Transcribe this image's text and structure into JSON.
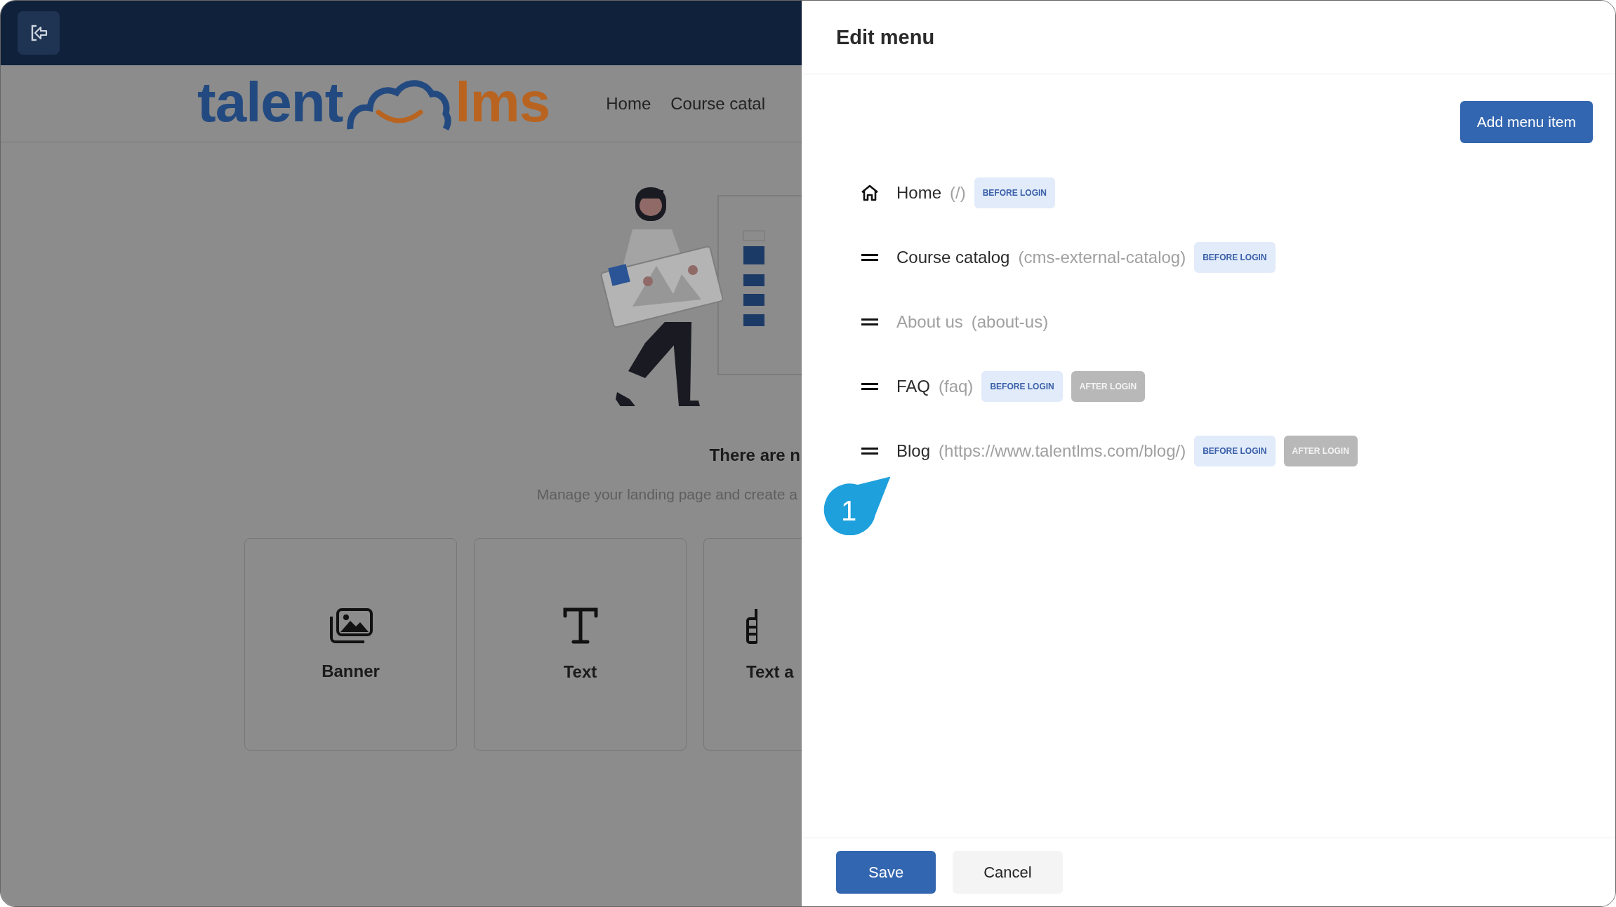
{
  "site_header": {
    "logo": {
      "left": "talent",
      "right": "lms"
    },
    "nav": [
      "Home",
      "Course catal"
    ]
  },
  "empty_state": {
    "title": "There are n",
    "subtitle": "Manage your landing page and create a"
  },
  "cards": [
    {
      "label": "Banner",
      "kind": "banner"
    },
    {
      "label": "Text",
      "kind": "text"
    },
    {
      "label": "Text a",
      "kind": "text-image"
    }
  ],
  "drawer": {
    "title": "Edit menu",
    "add_button": "Add menu item",
    "items": [
      {
        "kind": "home",
        "label": "Home",
        "path": "(/)",
        "disabled": false,
        "tags": [
          {
            "label": "BEFORE LOGIN",
            "kind": "before"
          }
        ]
      },
      {
        "kind": "drag",
        "label": "Course catalog",
        "path": "(cms-external-catalog)",
        "disabled": false,
        "tags": [
          {
            "label": "BEFORE LOGIN",
            "kind": "before"
          }
        ]
      },
      {
        "kind": "drag",
        "label": "About us",
        "path": "(about-us)",
        "disabled": true
      },
      {
        "kind": "drag",
        "label": "FAQ",
        "path": "(faq)",
        "disabled": false,
        "tags": [
          {
            "label": "BEFORE LOGIN",
            "kind": "before"
          },
          {
            "label": "AFTER LOGIN",
            "kind": "after"
          }
        ]
      },
      {
        "kind": "drag",
        "label": "Blog",
        "path": "(https://www.talentlms.com/blog/)",
        "disabled": false,
        "tags": [
          {
            "label": "BEFORE LOGIN",
            "kind": "before"
          },
          {
            "label": "AFTER LOGIN",
            "kind": "after"
          }
        ]
      }
    ],
    "buttons": [
      {
        "label": "Save",
        "kind": "primary"
      },
      {
        "label": "Cancel",
        "kind": "secondary"
      }
    ]
  },
  "callout": {
    "text": "1"
  }
}
